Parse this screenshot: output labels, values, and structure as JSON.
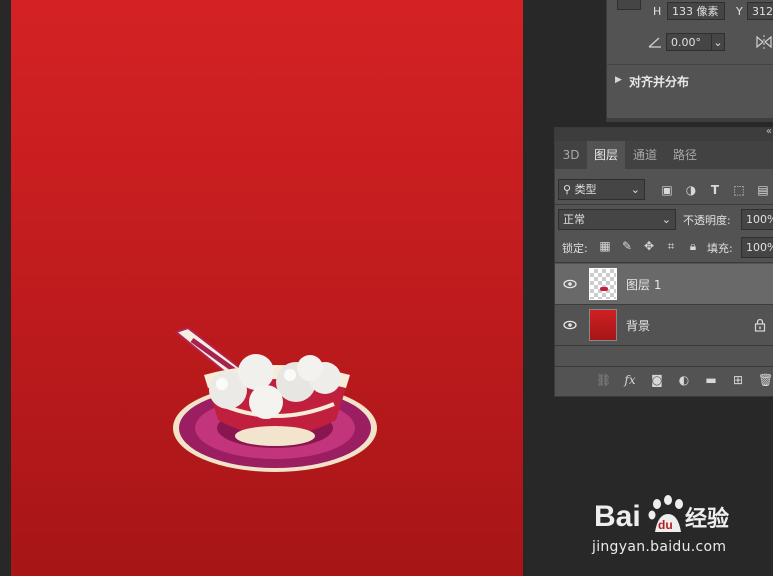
{
  "properties": {
    "h_label": "H",
    "h_value": "133 像素",
    "y_label": "Y",
    "y_value": "312",
    "angle_value": "0.00°",
    "align_section_title": "对齐并分布"
  },
  "layers_panel": {
    "tabs": [
      {
        "label": "3D",
        "active": false
      },
      {
        "label": "图层",
        "active": true
      },
      {
        "label": "通道",
        "active": false
      },
      {
        "label": "路径",
        "active": false
      }
    ],
    "filter_kind": "类型",
    "blend_mode": "正常",
    "opacity_label": "不透明度:",
    "opacity_value": "100%",
    "lock_label": "锁定:",
    "fill_label": "填充:",
    "fill_value": "100%",
    "layers": [
      {
        "name": "图层 1",
        "selected": true,
        "visible": true,
        "locked": false
      },
      {
        "name": "背景",
        "selected": false,
        "visible": true,
        "locked": true
      }
    ],
    "bottom_icons": [
      "link-icon",
      "fx-icon",
      "mask-icon",
      "adjustment-icon",
      "folder-icon",
      "new-layer-icon",
      "trash-icon"
    ]
  },
  "canvas": {
    "background_top": "#d42224",
    "background_bottom": "#a71517"
  },
  "watermark": {
    "logo_text": "Bai du 经验",
    "url": "jingyan.baidu.com"
  }
}
